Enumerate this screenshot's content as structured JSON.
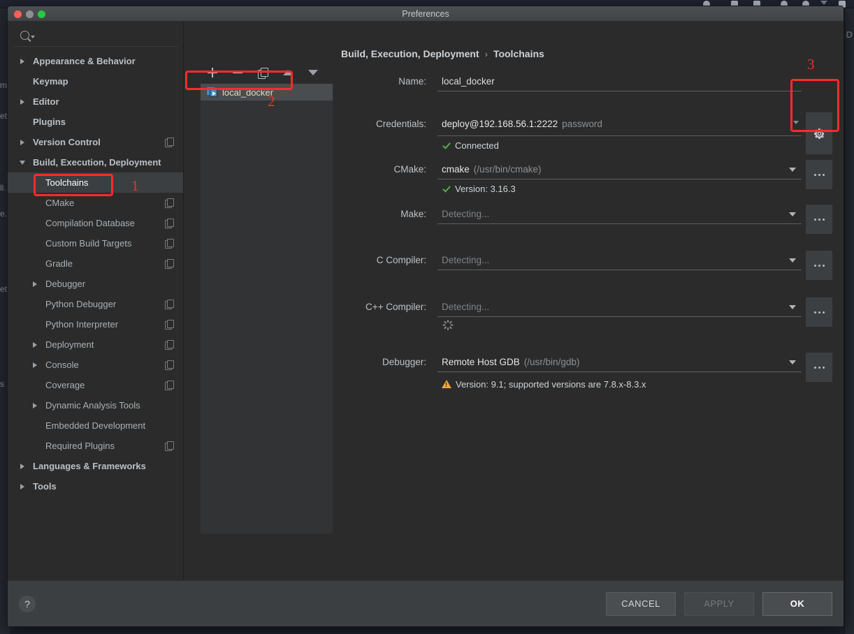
{
  "background": {
    "right_text_fragment": "D",
    "left_text_fragments": [
      "m",
      "et",
      "ll.",
      "e.",
      "et",
      "s"
    ]
  },
  "window": {
    "title": "Preferences",
    "traffic_lights": [
      "close-button",
      "minimize-button",
      "maximize-button"
    ]
  },
  "sidebar": {
    "search": {
      "value": "",
      "placeholder": "",
      "icon": "search-icon"
    },
    "items": [
      {
        "label": "Appearance & Behavior",
        "arrow": "right",
        "bold": true,
        "indent": 0,
        "badge": false,
        "selected": false
      },
      {
        "label": "Keymap",
        "arrow": "none",
        "bold": true,
        "indent": 0,
        "badge": false,
        "selected": false
      },
      {
        "label": "Editor",
        "arrow": "right",
        "bold": true,
        "indent": 0,
        "badge": false,
        "selected": false
      },
      {
        "label": "Plugins",
        "arrow": "none",
        "bold": true,
        "indent": 0,
        "badge": false,
        "selected": false
      },
      {
        "label": "Version Control",
        "arrow": "right",
        "bold": true,
        "indent": 0,
        "badge": true,
        "selected": false
      },
      {
        "label": "Build, Execution, Deployment",
        "arrow": "down",
        "bold": true,
        "indent": 0,
        "badge": false,
        "selected": false
      },
      {
        "label": "Toolchains",
        "arrow": "none",
        "bold": false,
        "indent": 1,
        "badge": false,
        "selected": true
      },
      {
        "label": "CMake",
        "arrow": "none",
        "bold": false,
        "indent": 1,
        "badge": true,
        "selected": false
      },
      {
        "label": "Compilation Database",
        "arrow": "none",
        "bold": false,
        "indent": 1,
        "badge": true,
        "selected": false
      },
      {
        "label": "Custom Build Targets",
        "arrow": "none",
        "bold": false,
        "indent": 1,
        "badge": true,
        "selected": false
      },
      {
        "label": "Gradle",
        "arrow": "none",
        "bold": false,
        "indent": 1,
        "badge": true,
        "selected": false
      },
      {
        "label": "Debugger",
        "arrow": "right",
        "bold": false,
        "indent": 1,
        "badge": false,
        "selected": false
      },
      {
        "label": "Python Debugger",
        "arrow": "none",
        "bold": false,
        "indent": 1,
        "badge": true,
        "selected": false
      },
      {
        "label": "Python Interpreter",
        "arrow": "none",
        "bold": false,
        "indent": 1,
        "badge": true,
        "selected": false
      },
      {
        "label": "Deployment",
        "arrow": "right",
        "bold": false,
        "indent": 1,
        "badge": true,
        "selected": false
      },
      {
        "label": "Console",
        "arrow": "right",
        "bold": false,
        "indent": 1,
        "badge": true,
        "selected": false
      },
      {
        "label": "Coverage",
        "arrow": "none",
        "bold": false,
        "indent": 1,
        "badge": true,
        "selected": false
      },
      {
        "label": "Dynamic Analysis Tools",
        "arrow": "right",
        "bold": false,
        "indent": 1,
        "badge": false,
        "selected": false
      },
      {
        "label": "Embedded Development",
        "arrow": "none",
        "bold": false,
        "indent": 1,
        "badge": false,
        "selected": false
      },
      {
        "label": "Required Plugins",
        "arrow": "none",
        "bold": false,
        "indent": 1,
        "badge": true,
        "selected": false
      },
      {
        "label": "Languages & Frameworks",
        "arrow": "right",
        "bold": true,
        "indent": 0,
        "badge": false,
        "selected": false
      },
      {
        "label": "Tools",
        "arrow": "right",
        "bold": true,
        "indent": 0,
        "badge": false,
        "selected": false
      }
    ]
  },
  "breadcrumb": {
    "parent": "Build, Execution, Deployment",
    "separator": "›",
    "current": "Toolchains"
  },
  "toolchain_list": {
    "toolbar": [
      {
        "name": "add-toolchain-button",
        "icon": "plus-icon"
      },
      {
        "name": "remove-toolchain-button",
        "icon": "minus-icon"
      },
      {
        "name": "copy-toolchain-button",
        "icon": "copy-icon"
      },
      {
        "name": "move-up-button",
        "icon": "arrow-up-icon"
      },
      {
        "name": "move-down-button",
        "icon": "arrow-down-icon"
      }
    ],
    "rows": [
      {
        "label": "local_docker",
        "icon": "docker-icon",
        "selected": true
      }
    ]
  },
  "form": {
    "name": {
      "label": "Name:",
      "value": "local_docker"
    },
    "credentials": {
      "label": "Credentials:",
      "value": "deploy@192.168.56.1:2222",
      "value_suffix": "password",
      "status_icon": "check-icon",
      "status_text": "Connected",
      "edit_button_icon": "gear-icon"
    },
    "cmake": {
      "label": "CMake:",
      "value": "cmake",
      "value_suffix": "(/usr/bin/cmake)",
      "status_icon": "check-icon",
      "status_text": "Version: 3.16.3",
      "browse_button_icon": "ellipsis-icon"
    },
    "make": {
      "label": "Make:",
      "placeholder": "Detecting...",
      "browse_button_icon": "ellipsis-icon"
    },
    "c_compiler": {
      "label": "C Compiler:",
      "placeholder": "Detecting...",
      "browse_button_icon": "ellipsis-icon"
    },
    "cxx_compiler": {
      "label": "C++ Compiler:",
      "placeholder": "Detecting...",
      "browse_button_icon": "ellipsis-icon",
      "spinner_icon": "loading-spinner-icon"
    },
    "debugger": {
      "label": "Debugger:",
      "value": "Remote Host GDB",
      "value_suffix": "(/usr/bin/gdb)",
      "status_icon": "warning-icon",
      "status_text": "Version: 9.1; supported versions are 7.8.x-8.3.x",
      "browse_button_icon": "ellipsis-icon"
    }
  },
  "footer": {
    "help_label": "?",
    "cancel_label": "CANCEL",
    "apply_label": "APPLY",
    "ok_label": "OK"
  },
  "annotations": {
    "one": "1",
    "two": "2",
    "three": "3"
  },
  "colors": {
    "annotation_red": "#e8342f",
    "success_green": "#4fb04f",
    "warning_orange": "#f0a732",
    "docker_blue": "#3592c4",
    "dialog_bg": "#2b2b2b",
    "footer_bg": "#3c3f41"
  }
}
